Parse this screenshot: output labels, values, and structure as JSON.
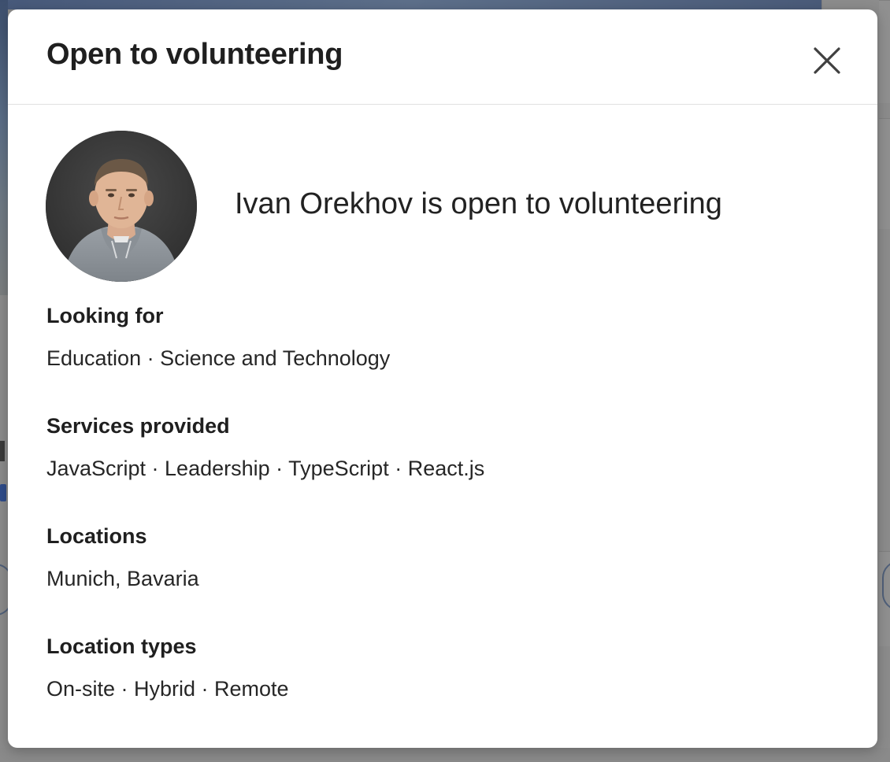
{
  "modal": {
    "title": "Open to volunteering",
    "close_icon": "close-icon"
  },
  "profile": {
    "statement": "Ivan Orekhov is open to volunteering",
    "avatar_icon": "profile-photo"
  },
  "sections": [
    {
      "heading": "Looking for",
      "value": "Education · Science and Technology"
    },
    {
      "heading": "Services provided",
      "value": "JavaScript · Leadership · TypeScript · React.js"
    },
    {
      "heading": "Locations",
      "value": "Munich, Bavaria"
    },
    {
      "heading": "Location types",
      "value": "On-site · Hybrid · Remote"
    }
  ],
  "colors": {
    "text_primary": "#1f1f1f",
    "divider": "#e0e0e0",
    "backdrop": "#8b8b8b"
  }
}
